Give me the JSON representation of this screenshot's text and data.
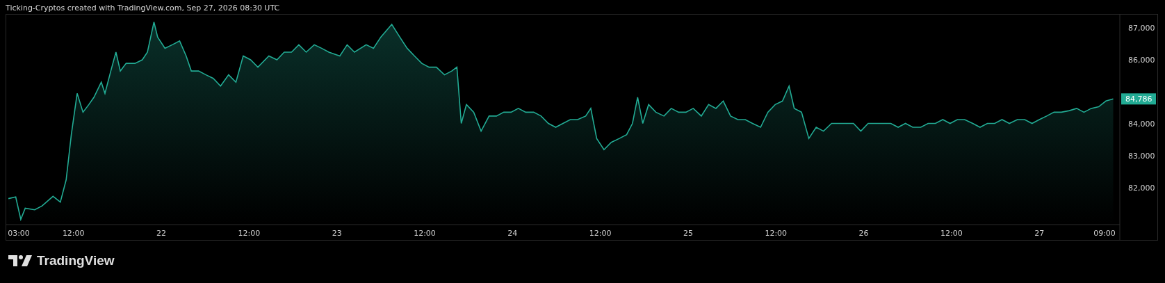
{
  "header": {
    "text": "Ticking-Cryptos created with TradingView.com, Sep 27, 2026 08:30 UTC"
  },
  "chart": {
    "chart_data": {
      "type": "area",
      "x": [
        "2026-09-21T03:06",
        "2026-09-21T04:06",
        "2026-09-21T04:48",
        "2026-09-21T05:24",
        "2026-09-21T06:42",
        "2026-09-21T07:42",
        "2026-09-21T09:12",
        "2026-09-21T10:12",
        "2026-09-21T11:00",
        "2026-09-21T11:42",
        "2026-09-21T12:30",
        "2026-09-21T13:18",
        "2026-09-21T14:06",
        "2026-09-21T14:48",
        "2026-09-21T15:48",
        "2026-09-21T16:18",
        "2026-09-21T17:06",
        "2026-09-21T17:48",
        "2026-09-21T18:24",
        "2026-09-21T19:12",
        "2026-09-21T20:24",
        "2026-09-21T21:24",
        "2026-09-21T22:06",
        "2026-09-21T23:00",
        "2026-09-21T23:30",
        "2026-09-22T00:30",
        "2026-09-22T01:30",
        "2026-09-22T02:30",
        "2026-09-22T03:24",
        "2026-09-22T04:06",
        "2026-09-22T05:06",
        "2026-09-22T06:06",
        "2026-09-22T07:06",
        "2026-09-22T08:06",
        "2026-09-22T09:12",
        "2026-09-22T10:12",
        "2026-09-22T11:12",
        "2026-09-22T12:12",
        "2026-09-22T13:12",
        "2026-09-22T14:42",
        "2026-09-22T15:48",
        "2026-09-22T16:48",
        "2026-09-22T17:48",
        "2026-09-22T18:48",
        "2026-09-22T19:48",
        "2026-09-22T20:54",
        "2026-09-22T21:54",
        "2026-09-22T22:54",
        "2026-09-23T00:24",
        "2026-09-23T01:24",
        "2026-09-23T02:24",
        "2026-09-23T04:00",
        "2026-09-23T05:00",
        "2026-09-23T06:00",
        "2026-09-23T07:30",
        "2026-09-23T08:36",
        "2026-09-23T09:36",
        "2026-09-23T10:36",
        "2026-09-23T11:36",
        "2026-09-23T12:36",
        "2026-09-23T13:36",
        "2026-09-23T14:42",
        "2026-09-23T15:42",
        "2026-09-23T16:24",
        "2026-09-23T17:00",
        "2026-09-23T17:42",
        "2026-09-23T18:42",
        "2026-09-23T19:42",
        "2026-09-23T20:48",
        "2026-09-23T21:48",
        "2026-09-23T22:48",
        "2026-09-23T23:48",
        "2026-09-24T00:48",
        "2026-09-24T01:48",
        "2026-09-24T02:54",
        "2026-09-24T03:54",
        "2026-09-24T04:54",
        "2026-09-24T05:54",
        "2026-09-24T06:54",
        "2026-09-24T07:54",
        "2026-09-24T08:54",
        "2026-09-24T10:00",
        "2026-09-24T10:42",
        "2026-09-24T11:30",
        "2026-09-24T12:30",
        "2026-09-24T13:30",
        "2026-09-24T14:36",
        "2026-09-24T15:36",
        "2026-09-24T16:24",
        "2026-09-24T17:06",
        "2026-09-24T17:48",
        "2026-09-24T18:36",
        "2026-09-24T19:36",
        "2026-09-24T20:42",
        "2026-09-24T21:42",
        "2026-09-24T22:42",
        "2026-09-24T23:42",
        "2026-09-25T00:42",
        "2026-09-25T01:48",
        "2026-09-25T02:48",
        "2026-09-25T03:48",
        "2026-09-25T04:48",
        "2026-09-25T05:48",
        "2026-09-25T06:48",
        "2026-09-25T07:48",
        "2026-09-25T08:48",
        "2026-09-25T09:54",
        "2026-09-25T10:54",
        "2026-09-25T11:54",
        "2026-09-25T12:54",
        "2026-09-25T13:48",
        "2026-09-25T14:30",
        "2026-09-25T15:30",
        "2026-09-25T16:30",
        "2026-09-25T17:30",
        "2026-09-25T18:30",
        "2026-09-25T19:36",
        "2026-09-25T20:36",
        "2026-09-25T21:36",
        "2026-09-25T22:36",
        "2026-09-25T23:36",
        "2026-09-26T00:36",
        "2026-09-26T01:42",
        "2026-09-26T02:42",
        "2026-09-26T03:42",
        "2026-09-26T04:42",
        "2026-09-26T05:42",
        "2026-09-26T06:42",
        "2026-09-26T07:48",
        "2026-09-26T08:48",
        "2026-09-26T09:48",
        "2026-09-26T10:48",
        "2026-09-26T11:48",
        "2026-09-26T12:48",
        "2026-09-26T13:48",
        "2026-09-26T14:54",
        "2026-09-26T15:54",
        "2026-09-26T16:54",
        "2026-09-26T17:54",
        "2026-09-26T18:54",
        "2026-09-26T19:54",
        "2026-09-26T21:00",
        "2026-09-26T22:00",
        "2026-09-26T23:00",
        "2026-09-27T00:00",
        "2026-09-27T01:00",
        "2026-09-27T02:00",
        "2026-09-27T03:00",
        "2026-09-27T04:06",
        "2026-09-27T05:06",
        "2026-09-27T06:06",
        "2026-09-27T07:06",
        "2026-09-27T08:06",
        "2026-09-27T09:06",
        "2026-09-27T10:06"
      ],
      "series": [
        {
          "color": "#22ab94",
          "values": [
            81670,
            81720,
            81020,
            81370,
            81320,
            81440,
            81740,
            81560,
            82260,
            83670,
            84960,
            84370,
            84610,
            84840,
            85310,
            84960,
            85660,
            86250,
            85660,
            85900,
            85900,
            86010,
            86250,
            87190,
            86720,
            86370,
            86480,
            86600,
            86130,
            85660,
            85660,
            85540,
            85430,
            85190,
            85540,
            85310,
            86130,
            86010,
            85780,
            86130,
            86010,
            86250,
            86250,
            86480,
            86250,
            86480,
            86370,
            86250,
            86130,
            86480,
            86250,
            86480,
            86370,
            86720,
            87120,
            86720,
            86370,
            86130,
            85900,
            85780,
            85780,
            85540,
            85660,
            85780,
            84020,
            84610,
            84370,
            83780,
            84250,
            84250,
            84370,
            84370,
            84490,
            84370,
            84370,
            84250,
            84020,
            83900,
            84020,
            84140,
            84140,
            84250,
            84490,
            83550,
            83200,
            83430,
            83550,
            83670,
            84020,
            84840,
            84020,
            84610,
            84370,
            84250,
            84490,
            84370,
            84370,
            84490,
            84250,
            84610,
            84490,
            84720,
            84250,
            84140,
            84140,
            84020,
            83900,
            84370,
            84610,
            84720,
            85190,
            84490,
            84370,
            83550,
            83900,
            83780,
            84020,
            84020,
            84020,
            84020,
            83780,
            84020,
            84020,
            84020,
            84020,
            83900,
            84020,
            83900,
            83900,
            84020,
            84020,
            84140,
            84020,
            84140,
            84140,
            84020,
            83900,
            84020,
            84020,
            84140,
            84020,
            84140,
            84140,
            84020,
            84140,
            84250,
            84370,
            84370,
            84420,
            84490,
            84370,
            84490,
            84540,
            84720,
            84786
          ]
        }
      ],
      "xlim": [
        "2026-09-21T03:00",
        "2026-09-27T11:00"
      ],
      "ylim": [
        80900,
        87380
      ],
      "xticks": [
        {
          "value": "2026-09-21T03:00",
          "label": "03:00"
        },
        {
          "value": "2026-09-21T12:00",
          "label": "12:00"
        },
        {
          "value": "2026-09-22T00:00",
          "label": "22"
        },
        {
          "value": "2026-09-22T12:00",
          "label": "12:00"
        },
        {
          "value": "2026-09-23T00:00",
          "label": "23"
        },
        {
          "value": "2026-09-23T12:00",
          "label": "12:00"
        },
        {
          "value": "2026-09-24T00:00",
          "label": "24"
        },
        {
          "value": "2026-09-24T12:00",
          "label": "12:00"
        },
        {
          "value": "2026-09-25T00:00",
          "label": "25"
        },
        {
          "value": "2026-09-25T12:00",
          "label": "12:00"
        },
        {
          "value": "2026-09-26T00:00",
          "label": "26"
        },
        {
          "value": "2026-09-26T12:00",
          "label": "12:00"
        },
        {
          "value": "2026-09-27T00:00",
          "label": "27"
        },
        {
          "value": "2026-09-27T09:00",
          "label": "09:00"
        }
      ],
      "yticks": [
        {
          "value": 82000,
          "label": "82,000"
        },
        {
          "value": 83000,
          "label": "83,000"
        },
        {
          "value": 84000,
          "label": "84,000"
        },
        {
          "value": 86000,
          "label": "86,000"
        },
        {
          "value": 87000,
          "label": "87,000"
        }
      ]
    },
    "last_price_label": "84,786"
  },
  "footer": {
    "logo_text": "TradingView"
  }
}
